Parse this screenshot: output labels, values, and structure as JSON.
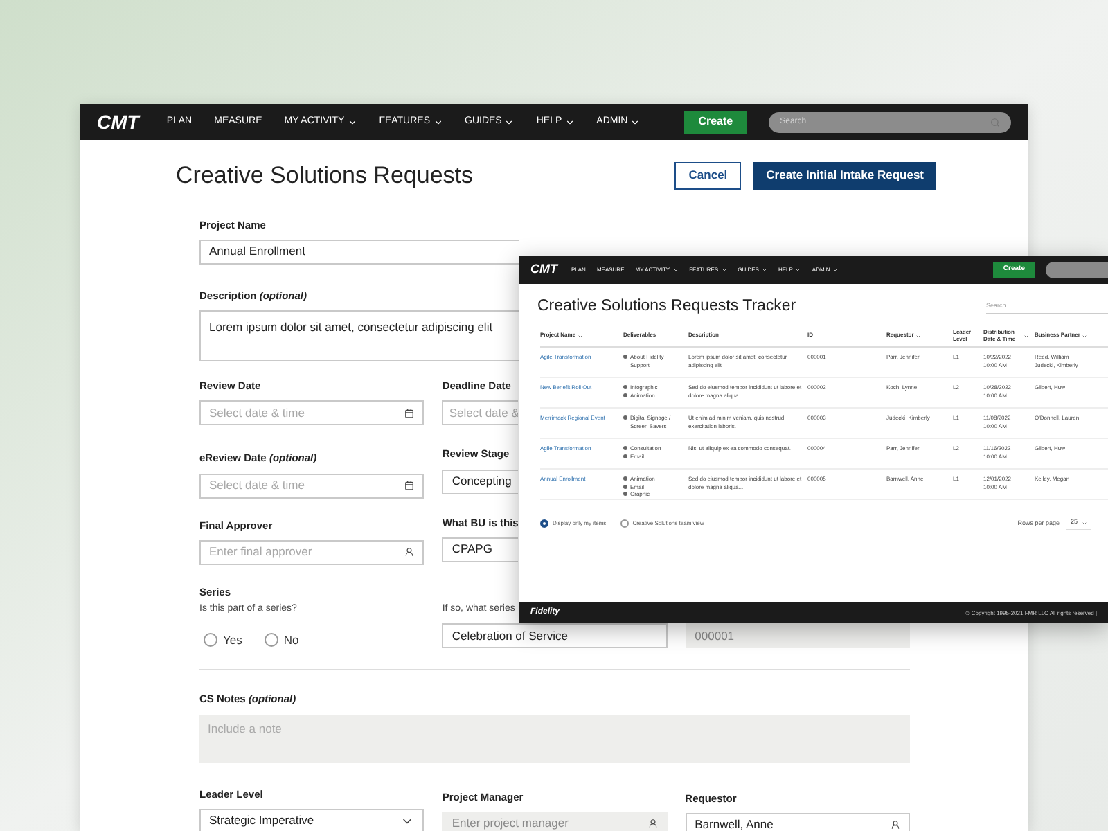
{
  "main": {
    "nav": {
      "logo": "CMT",
      "items": [
        {
          "label": "PLAN",
          "dropdown": false
        },
        {
          "label": "MEASURE",
          "dropdown": false
        },
        {
          "label": "MY ACTIVITY",
          "dropdown": true
        },
        {
          "label": "FEATURES",
          "dropdown": true
        },
        {
          "label": "GUIDES",
          "dropdown": true
        },
        {
          "label": "HELP",
          "dropdown": true
        },
        {
          "label": "ADMIN",
          "dropdown": true
        }
      ],
      "create": "Create",
      "search_placeholder": "Search"
    },
    "title": "Creative Solutions Requests",
    "cancel": "Cancel",
    "submit": "Create Initial Intake Request",
    "form": {
      "project_name": {
        "label": "Project Name",
        "value": "Annual Enrollment"
      },
      "description": {
        "label": "Description *(optional)*",
        "value": "Lorem ipsum dolor sit amet, consectetur adipiscing elit"
      },
      "review_date": {
        "label": "Review Date",
        "placeholder": "Select date & time"
      },
      "deadline_date": {
        "label": "Deadline Date",
        "placeholder": "Select date &"
      },
      "ereview_date": {
        "label": "eReview Date *(optional)*",
        "placeholder": "Select date & time"
      },
      "review_stage": {
        "label": "Review Stage",
        "value": "Concepting"
      },
      "final_approver": {
        "label": "Final Approver",
        "placeholder": "Enter final approver"
      },
      "bu": {
        "label": "What BU is this",
        "value": "CPAPG"
      },
      "series": {
        "label": "Series",
        "question": "Is this part of a series?",
        "options": [
          {
            "label": "Yes",
            "selected": false
          },
          {
            "label": "No",
            "selected": false
          }
        ]
      },
      "series_name": {
        "label": "If so, what series",
        "value": "Celebration of Service"
      },
      "series_id": {
        "placeholder": "000001",
        "disabled": true
      },
      "cs_notes": {
        "label": "CS Notes *(optional)*",
        "placeholder": "Include a note"
      },
      "leader_level": {
        "label": "Leader Level",
        "value": "Strategic Imperative"
      },
      "project_manager": {
        "label": "Project Manager",
        "placeholder": "Enter project manager",
        "disabled": true
      },
      "requestor": {
        "label": "Requestor",
        "value": "Barnwell, Anne"
      }
    }
  },
  "tracker": {
    "nav": {
      "logo": "CMT",
      "items": [
        {
          "label": "PLAN",
          "dropdown": false
        },
        {
          "label": "MEASURE",
          "dropdown": false
        },
        {
          "label": "MY ACTIVITY",
          "dropdown": true
        },
        {
          "label": "FEATURES",
          "dropdown": true
        },
        {
          "label": "GUIDES",
          "dropdown": true
        },
        {
          "label": "HELP",
          "dropdown": true
        },
        {
          "label": "ADMIN",
          "dropdown": true
        }
      ],
      "create": "Create"
    },
    "title": "Creative Solutions Requests Tracker",
    "search_placeholder": "Search",
    "columns": [
      {
        "label": "Project Name",
        "sortable": true
      },
      {
        "label": "Deliverables",
        "sortable": false
      },
      {
        "label": "Description",
        "sortable": false
      },
      {
        "label": "ID",
        "sortable": false
      },
      {
        "label": "Requestor",
        "sortable": true
      },
      {
        "label": "Leader Level",
        "sortable": false
      },
      {
        "label": "Distribution Date & Time",
        "sortable": true
      },
      {
        "label": "Business Partner",
        "sortable": true
      }
    ],
    "rows": [
      {
        "project": "Agile Transformation",
        "deliverables": [
          "About Fidelity Support"
        ],
        "description": "Lorem ipsum dolor sit amet, consectetur adipiscing elit",
        "id": "000001",
        "requestor": "Parr, Jennifer",
        "leader_level": "L1",
        "date": "10/22/2022",
        "time": "10:00 AM",
        "partners": [
          "Reed, William",
          "Judecki, Kimberly"
        ]
      },
      {
        "project": "New Benefit Roll Out",
        "deliverables": [
          "Infographic",
          "Animation"
        ],
        "description": "Sed do eiusmod tempor incididunt ut labore et dolore magna aliqua...",
        "id": "000002",
        "requestor": "Koch, Lynne",
        "leader_level": "L2",
        "date": "10/28/2022",
        "time": "10:00 AM",
        "partners": [
          "Gilbert, Huw"
        ]
      },
      {
        "project": "Merrimack Regional Event",
        "deliverables": [
          "Digital Signage / Screen Savers"
        ],
        "description": "Ut enim ad minim veniam, quis nostrud exercitation laboris.",
        "id": "000003",
        "requestor": "Judecki, Kimberly",
        "leader_level": "L1",
        "date": "11/08/2022",
        "time": "10:00 AM",
        "partners": [
          "O'Donnell, Lauren"
        ]
      },
      {
        "project": "Agile Transformation",
        "deliverables": [
          "Consultation",
          "Email"
        ],
        "description": "Nisi ut aliquip ex ea commodo consequat.",
        "id": "000004",
        "requestor": "Parr, Jennifer",
        "leader_level": "L2",
        "date": "11/16/2022",
        "time": "10:00 AM",
        "partners": [
          "Gilbert, Huw"
        ]
      },
      {
        "project": "Annual Enrollment",
        "deliverables": [
          "Animation",
          "Email",
          "Graphic"
        ],
        "description": "Sed do eiusmod tempor incididunt ut labore et dolore magna aliqua...",
        "id": "000005",
        "requestor": "Barnwell, Anne",
        "leader_level": "L1",
        "date": "12/01/2022",
        "time": "10:00 AM",
        "partners": [
          "Kelley, Megan"
        ]
      }
    ],
    "views": [
      {
        "label": "Display only my items",
        "selected": true
      },
      {
        "label": "Creative Solutions team view",
        "selected": false
      }
    ],
    "rows_per_page_label": "Rows per page",
    "rows_per_page": "25",
    "footer": {
      "logo": "Fidelity",
      "copyright": "© Copyright 1995-2021 FMR LLC All rights reserved |"
    }
  }
}
